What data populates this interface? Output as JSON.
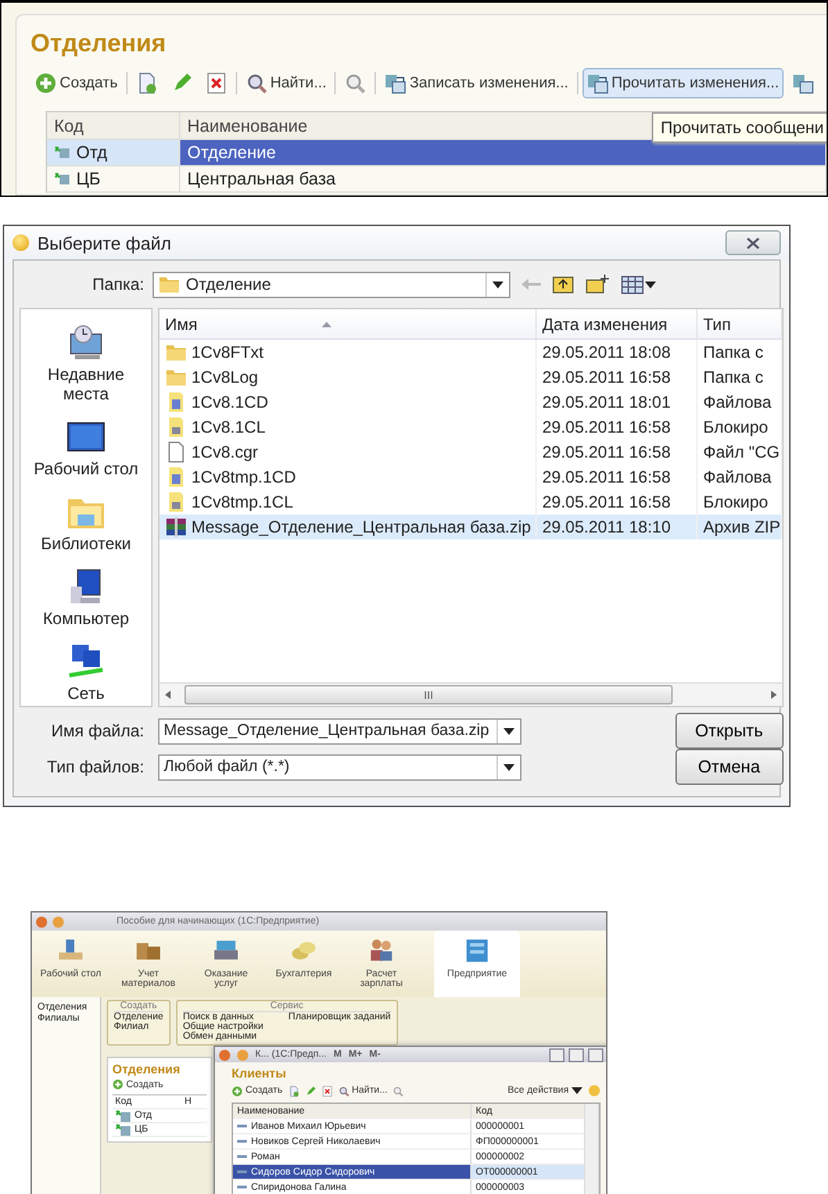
{
  "departments_form": {
    "title": "Отделения",
    "toolbar": [
      {
        "kind": "create",
        "label": "Создать",
        "pressed": false
      },
      {
        "kind": "separator"
      },
      {
        "kind": "copy",
        "pressed": false
      },
      {
        "kind": "edit",
        "pressed": false
      },
      {
        "kind": "delete",
        "pressed": false
      },
      {
        "kind": "separator"
      },
      {
        "kind": "find",
        "label": "Найти...",
        "pressed": false
      },
      {
        "kind": "separator"
      },
      {
        "kind": "clear-find",
        "pressed": false
      },
      {
        "kind": "separator"
      },
      {
        "kind": "write",
        "label": "Записать изменения...",
        "pressed": false
      },
      {
        "kind": "separator"
      },
      {
        "kind": "read",
        "label": "Прочитать изменения...",
        "pressed": true
      },
      {
        "kind": "more",
        "pressed": false
      }
    ],
    "columns": [
      "Код",
      "Наименование"
    ],
    "rows": [
      {
        "code": "Отд",
        "name": "Отделение",
        "selected": true
      },
      {
        "code": "ЦБ",
        "name": "Центральная база",
        "selected": false
      }
    ],
    "tooltip": "Прочитать сообщени"
  },
  "file_dialog": {
    "title": "Выберите файл",
    "folder_label": "Папка:",
    "folder": "Отделение",
    "places": [
      {
        "kind": "recent",
        "label": "Недавние места"
      },
      {
        "kind": "desktop",
        "label": "Рабочий стол"
      },
      {
        "kind": "libraries",
        "label": "Библиотеки"
      },
      {
        "kind": "computer",
        "label": "Компьютер"
      },
      {
        "kind": "network",
        "label": "Сеть"
      }
    ],
    "columns": [
      "Имя",
      "Дата изменения",
      "Тип"
    ],
    "files": [
      {
        "kind": "folder",
        "name": "1Cv8FTxt",
        "date": "29.05.2011 18:08",
        "type": "Папка с",
        "selected": false
      },
      {
        "kind": "folder",
        "name": "1Cv8Log",
        "date": "29.05.2011 16:58",
        "type": "Папка с",
        "selected": false
      },
      {
        "kind": "database",
        "name": "1Cv8.1CD",
        "date": "29.05.2011 18:01",
        "type": "Файлова",
        "selected": false
      },
      {
        "kind": "lock",
        "name": "1Cv8.1CL",
        "date": "29.05.2011 16:58",
        "type": "Блокиро",
        "selected": false
      },
      {
        "kind": "file",
        "name": "1Cv8.cgr",
        "date": "29.05.2011 16:58",
        "type": "Файл \"CG",
        "selected": false
      },
      {
        "kind": "database",
        "name": "1Cv8tmp.1CD",
        "date": "29.05.2011 16:58",
        "type": "Файлова",
        "selected": false
      },
      {
        "kind": "lock",
        "name": "1Cv8tmp.1CL",
        "date": "29.05.2011 16:58",
        "type": "Блокиро",
        "selected": false
      },
      {
        "kind": "archive",
        "name": "Message_Отделение_Центральная база.zip",
        "date": "29.05.2011 18:10",
        "type": "Архив ZIP",
        "selected": true
      }
    ],
    "scroll_mark": "III",
    "filename_label": "Имя файла:",
    "filename": "Message_Отделение_Центральная база.zip",
    "filetype_label": "Тип файлов:",
    "filetype": "Любой файл (*.*)",
    "buttons": [
      "Открыть",
      "Отмена"
    ]
  },
  "app_window": {
    "title": "Пособие для начинающих (1С:Предприятие)",
    "sections": [
      {
        "kind": "desk",
        "label": "Рабочий стол",
        "selected": false
      },
      {
        "kind": "materials",
        "label": "Учет материалов",
        "selected": false
      },
      {
        "kind": "services",
        "label": "Оказание услуг",
        "selected": false
      },
      {
        "kind": "accounting",
        "label": "Бухгалтерия",
        "selected": false
      },
      {
        "kind": "payroll",
        "label": "Расчет зарплаты",
        "selected": false
      },
      {
        "kind": "enterprise",
        "label": "Предприятие",
        "selected": true
      }
    ],
    "nav": [
      "Отделения",
      "Филиалы"
    ],
    "create_group": {
      "title": "Создать",
      "items": [
        "Отделение",
        "Филиал"
      ]
    },
    "service_group": {
      "title": "Сервис",
      "items": [
        "Поиск в данных",
        "Общие настройки",
        "Обмен данными"
      ],
      "items_2": [
        "Планировщик заданий"
      ]
    },
    "back_form": {
      "title": "Отделения",
      "create": "Создать",
      "columns": [
        "Код",
        "Н"
      ],
      "rows": [
        "Отд",
        "ЦБ"
      ]
    },
    "clients_window": {
      "title": "К... (1С:Предп...",
      "memory": [
        "M",
        "M+",
        "M-"
      ],
      "heading": "Клиенты",
      "create": "Создать",
      "find": "Найти...",
      "all_actions": "Все действия",
      "columns": [
        "Наименование",
        "Код"
      ],
      "rows": [
        {
          "name": "Иванов Михаил Юрьевич",
          "code": "000000001",
          "selected": false
        },
        {
          "name": "Новиков Сергей Николаевич",
          "code": "ФП000000001",
          "selected": false
        },
        {
          "name": "Роман",
          "code": "000000002",
          "selected": false
        },
        {
          "name": "Сидоров Сидор Сидорович",
          "code": "ОТ000000001",
          "selected": true
        },
        {
          "name": "Спиридонова Галина",
          "code": "000000003",
          "selected": false
        }
      ]
    }
  }
}
